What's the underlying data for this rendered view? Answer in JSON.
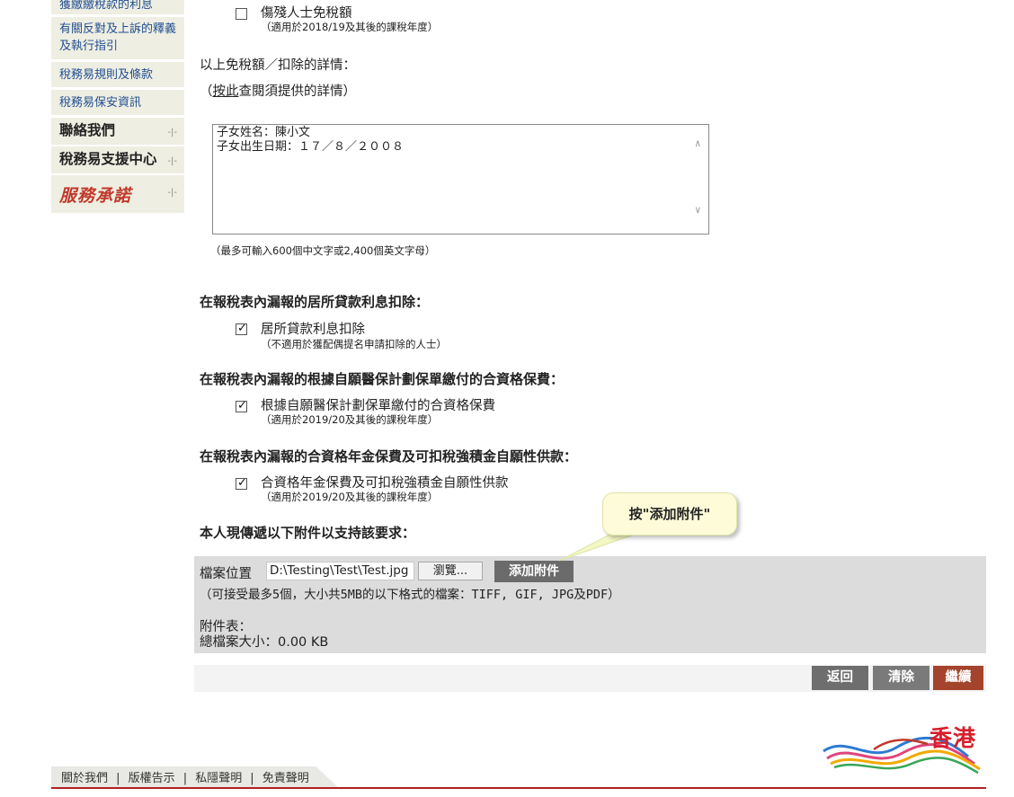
{
  "sidebar": {
    "items": [
      {
        "label": "獲繳繳稅款的利息"
      },
      {
        "label": "有關反對及上訴的釋義及執行指引"
      },
      {
        "label": "稅務易規則及條款"
      },
      {
        "label": "稅務易保安資訊"
      },
      {
        "label": "聯絡我們"
      },
      {
        "label": "稅務易支援中心"
      },
      {
        "label": "服務承諾"
      }
    ],
    "arrow": "-|-"
  },
  "disabled_allowance": {
    "label": "傷殘人士免稅額",
    "note": "（適用於2018/19及其後的課稅年度）"
  },
  "details": {
    "heading": "以上免稅額／扣除的詳情：",
    "hint_prefix": "（",
    "hint_link": "按此",
    "hint_suffix": "查閱須提供的詳情）",
    "textarea_line1": "子女姓名：陳小文",
    "textarea_line2": "子女出生日期：１７／８／２００８",
    "limit_note": "（最多可輸入600個中文字或2,400個英文字母）"
  },
  "sections": [
    {
      "heading": "在報稅表內漏報的居所貸款利息扣除：",
      "label": "居所貸款利息扣除",
      "note": "（不適用於獲配偶提名申請扣除的人士）",
      "checked": true
    },
    {
      "heading": "在報稅表內漏報的根據自願醫保計劃保單繳付的合資格保費：",
      "label": "根據自願醫保計劃保單繳付的合資格保費",
      "note": "（適用於2019/20及其後的課稅年度）",
      "checked": true
    },
    {
      "heading": "在報稅表內漏報的合資格年金保費及可扣稅強積金自願性供款：",
      "label": "合資格年金保費及可扣稅強積金自願性供款",
      "note": "（適用於2019/20及其後的課稅年度）",
      "checked": true
    }
  ],
  "attachments": {
    "heading": "本人現傳遞以下附件以支持該要求：",
    "file_label": "檔案位置",
    "file_value": "D:\\Testing\\Test\\Test.jpg",
    "browse_label": "瀏覽...",
    "add_label": "添加附件",
    "format_note": "（可接受最多5個，大小共5MB的以下格式的檔案：TIFF, GIF, JPG及PDF）",
    "list_label": "附件表：",
    "total_label": "總檔案大小：0.00 KB"
  },
  "callout": {
    "text": "按\"添加附件\""
  },
  "actions": {
    "back": "返回",
    "clear": "清除",
    "continue": "繼續"
  },
  "colors": {
    "back": "#6e6e6e",
    "clear": "#7a7a7a",
    "continue": "#a4442c",
    "link": "#1f4e91",
    "footer_line": "#b22222"
  },
  "footer": {
    "links": [
      "關於我們",
      "版權告示",
      "私隱聲明",
      "免責聲明"
    ],
    "separator": "|",
    "logo_text": "香港"
  }
}
